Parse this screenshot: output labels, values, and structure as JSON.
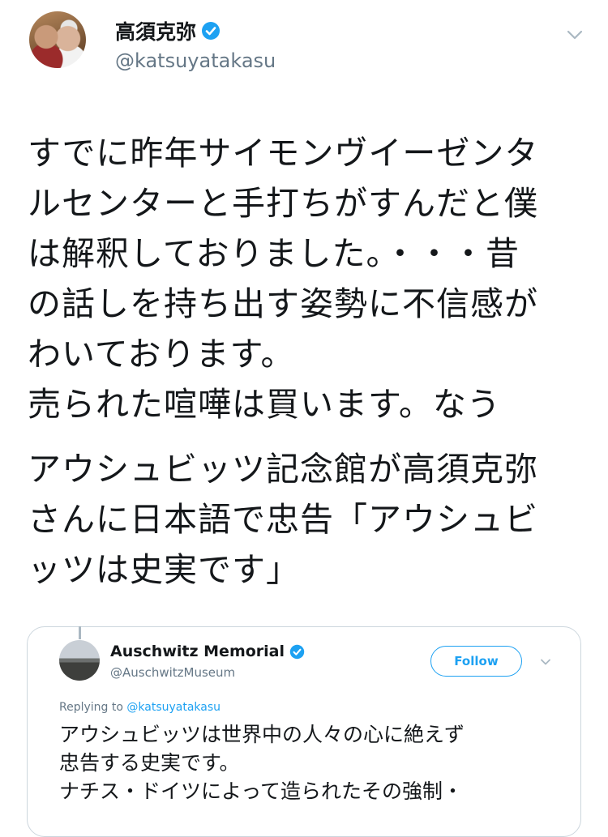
{
  "tweet": {
    "author_name": "高須克弥",
    "author_handle": "@katsuyatakasu",
    "text_lines": [
      "すでに昨年サイモンヴイーゼンタ",
      "ルセンターと手打ちがすんだと僕",
      "は解釈しておりました。・・・昔",
      "の話しを持ち出す姿勢に不信感が",
      "わいております。",
      "売られた喧嘩は買います。なう"
    ],
    "text_lines_2": [
      "アウシュビッツ記念館が高須克弥",
      "さんに日本語で忠告「アウシュビ",
      "ッツは史実です」"
    ],
    "icons": {
      "verified": "verified-badge-icon",
      "menu": "chevron-down-icon"
    }
  },
  "quoted": {
    "author_name": "Auschwitz Memorial",
    "author_handle": "@AuschwitzMuseum",
    "follow_label": "Follow",
    "replying_prefix": "Replying to ",
    "replying_handle": "@katsuyatakasu",
    "text_lines": [
      "アウシュビッツは世界中の人々の心に絶えず",
      "忠告する史実です。",
      "ナチス・ドイツによって造られたその強制・"
    ]
  },
  "colors": {
    "accent": "#1da1f2",
    "text": "#14171a",
    "secondary": "#657786",
    "border": "#ccd6dd"
  }
}
